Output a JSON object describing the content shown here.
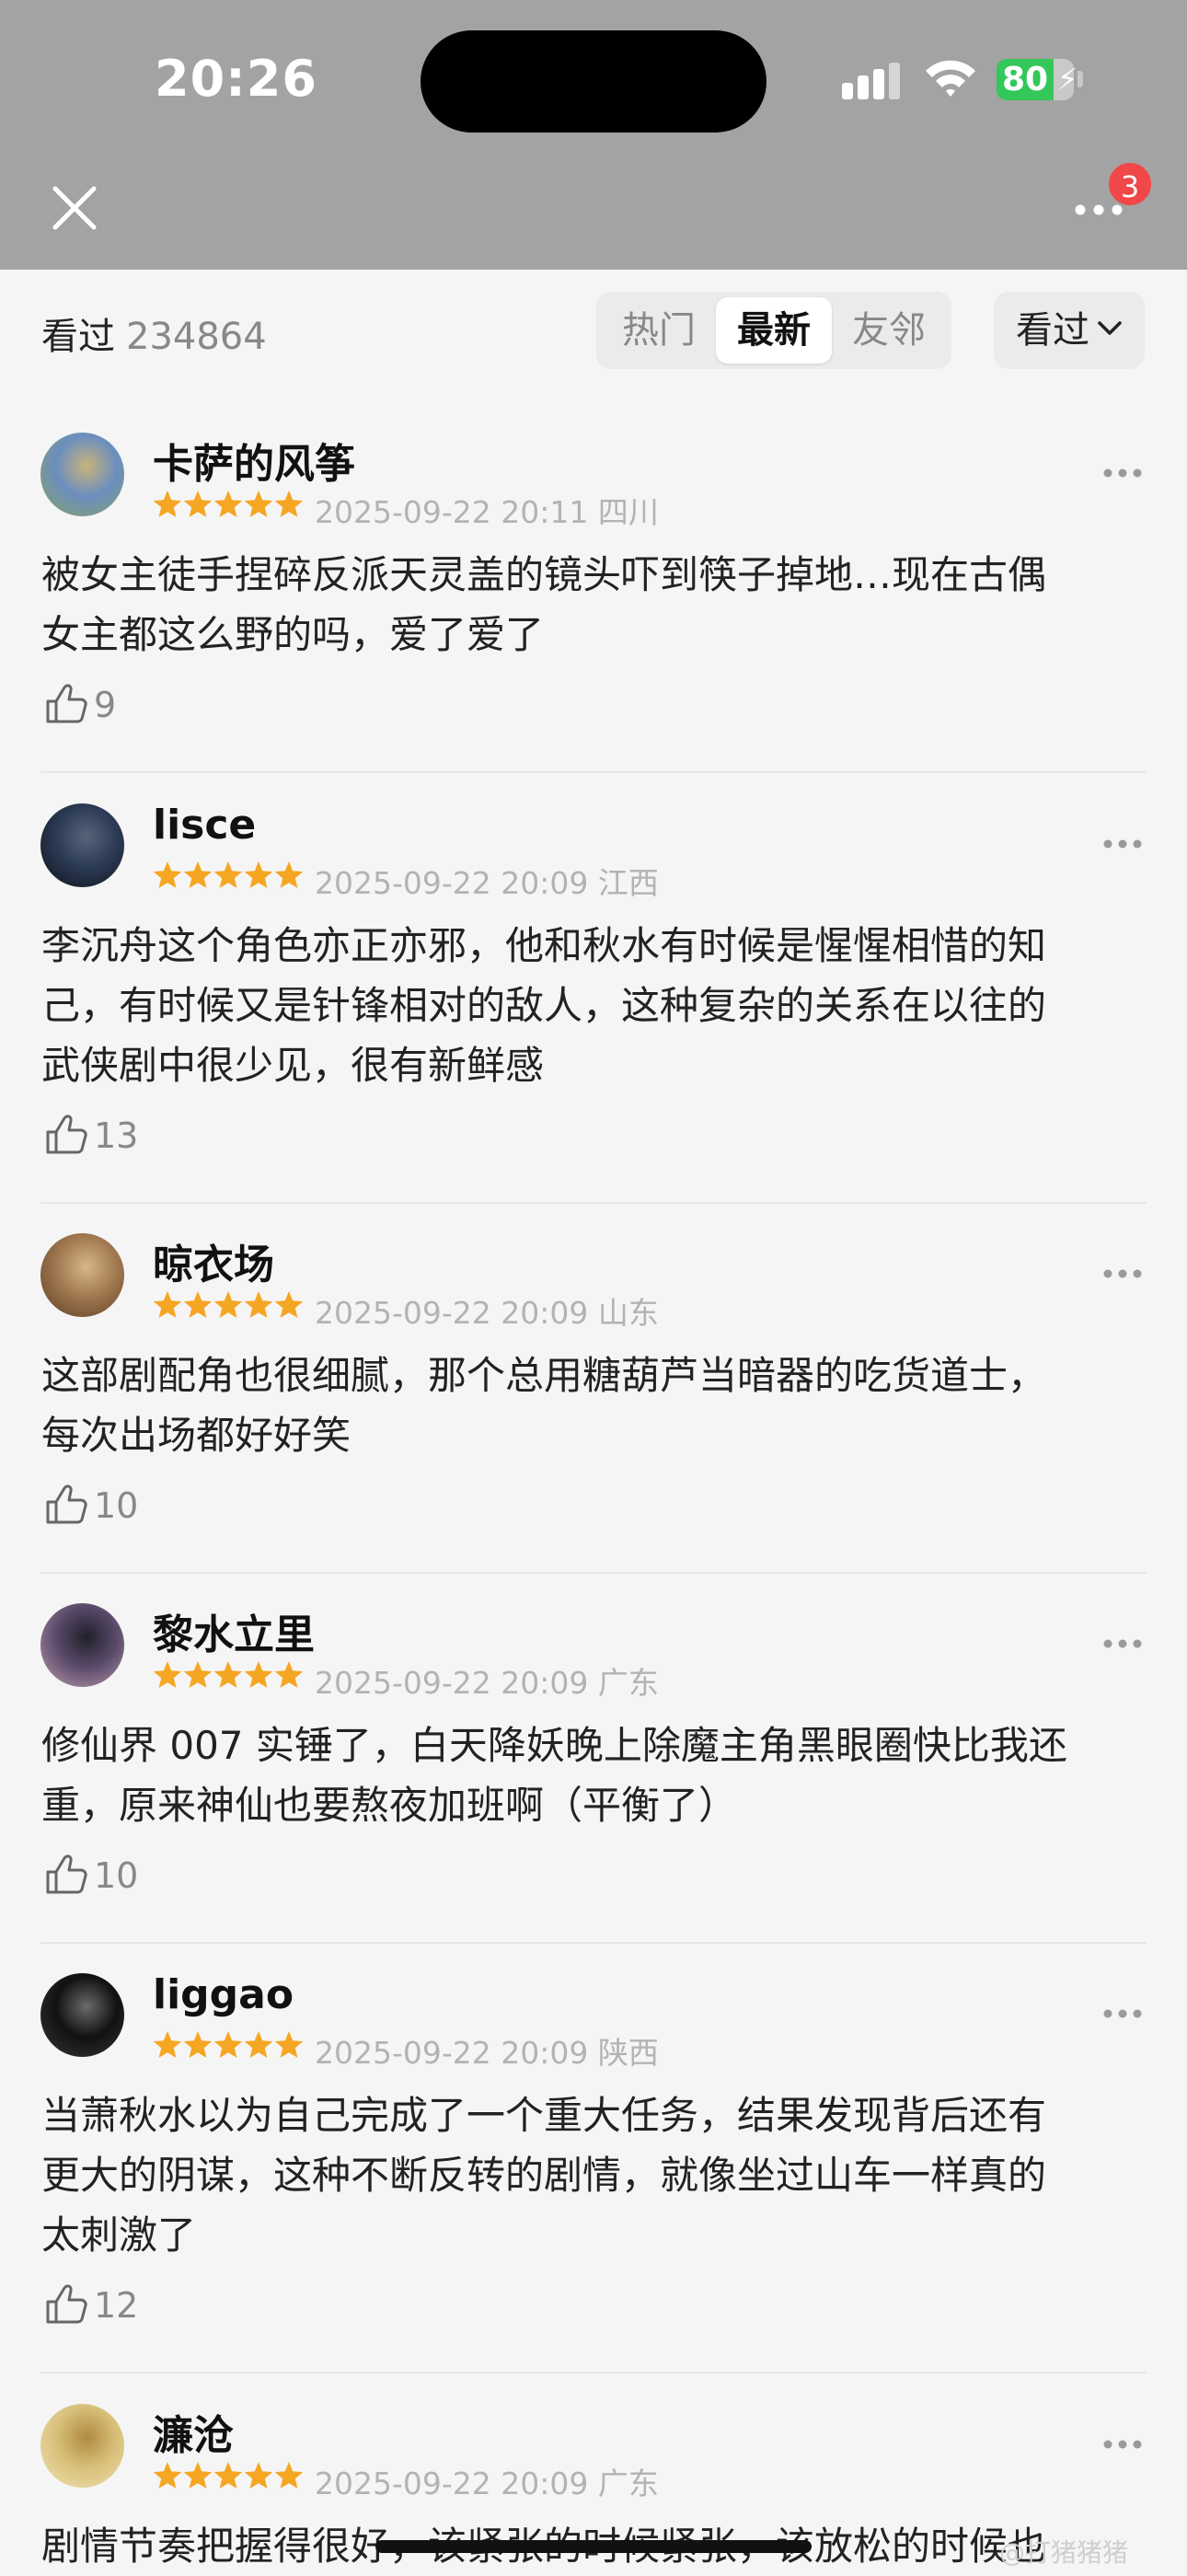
{
  "status_bar": {
    "time": "20:26",
    "battery": "80"
  },
  "header": {
    "notification_count": "3"
  },
  "filter": {
    "label": "看过",
    "count": "234864",
    "tabs": [
      "热门",
      "最新",
      "友邻"
    ],
    "active_tab": "最新",
    "dropdown_label": "看过"
  },
  "colors": {
    "star": "#f5a623",
    "badge": "#f04848",
    "topbar": "#a3a3a3"
  },
  "comments": [
    {
      "username": "卡萨的风筝",
      "rating": 5,
      "time": "2025-09-22 20:11",
      "location": "四川",
      "lines": [
        "被女主徒手捏碎反派天灵盖的镜头吓到筷子掉地…现在古偶",
        "女主都这么野的吗，爱了爱了"
      ],
      "likes": "9"
    },
    {
      "username": "lisce",
      "rating": 5,
      "time": "2025-09-22 20:09",
      "location": "江西",
      "lines": [
        "李沉舟这个角色亦正亦邪，他和秋水有时候是惺惺相惜的知",
        "己，有时候又是针锋相对的敌人，这种复杂的关系在以往的",
        "武侠剧中很少见，很有新鲜感"
      ],
      "likes": "13"
    },
    {
      "username": "晾衣场",
      "rating": 5,
      "time": "2025-09-22 20:09",
      "location": "山东",
      "lines": [
        "这部剧配角也很细腻，那个总用糖葫芦当暗器的吃货道士，",
        "每次出场都好好笑"
      ],
      "likes": "10"
    },
    {
      "username": "黎水立里",
      "rating": 5,
      "time": "2025-09-22 20:09",
      "location": "广东",
      "lines": [
        "修仙界 007 实锤了，白天降妖晚上除魔主角黑眼圈快比我还",
        "重，原来神仙也要熬夜加班啊（平衡了）"
      ],
      "likes": "10"
    },
    {
      "username": "liggao",
      "rating": 5,
      "time": "2025-09-22 20:09",
      "location": "陕西",
      "lines": [
        "当萧秋水以为自己完成了一个重大任务，结果发现背后还有",
        "更大的阴谋，这种不断反转的剧情，就像坐过山车一样真的",
        "太刺激了"
      ],
      "likes": "12"
    },
    {
      "username": "濂沧",
      "rating": 5,
      "time": "2025-09-22 20:09",
      "location": "广东",
      "lines": [
        "剧情节奏把握得很好，该紧张的时候紧张，该放松的时候也"
      ],
      "likes": ""
    }
  ],
  "watermark": "@打猪猪猪"
}
